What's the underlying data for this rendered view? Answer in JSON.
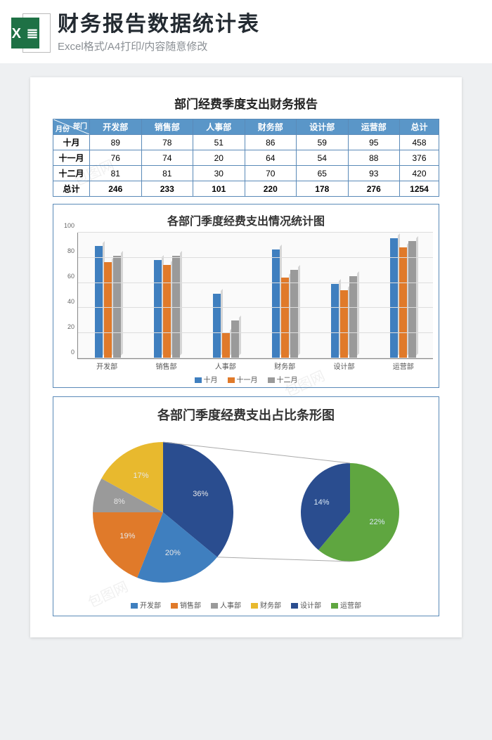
{
  "header": {
    "logo_text": "X ≣",
    "title": "财务报告数据统计表",
    "subtitle": "Excel格式/A4打印/内容随意修改"
  },
  "report_title": "部门经费季度支出财务报告",
  "table": {
    "corner": {
      "top": "部门",
      "bottom": "月份"
    },
    "columns": [
      "开发部",
      "销售部",
      "人事部",
      "财务部",
      "设计部",
      "运营部",
      "总计"
    ],
    "rows": [
      {
        "label": "十月",
        "values": [
          89,
          78,
          51,
          86,
          59,
          95,
          458
        ]
      },
      {
        "label": "十一月",
        "values": [
          76,
          74,
          20,
          64,
          54,
          88,
          376
        ]
      },
      {
        "label": "十二月",
        "values": [
          81,
          81,
          30,
          70,
          65,
          93,
          420
        ]
      },
      {
        "label": "总计",
        "values": [
          246,
          233,
          101,
          220,
          178,
          276,
          1254
        ]
      }
    ]
  },
  "bar_chart": {
    "title": "各部门季度经费支出情况统计图",
    "yticks": [
      0,
      20,
      40,
      60,
      80,
      100
    ],
    "legend": [
      "十月",
      "十一月",
      "十二月"
    ]
  },
  "pie_chart": {
    "title": "各部门季度经费支出占比条形图",
    "pie1_labels": {
      "a": "36%",
      "b": "20%",
      "c": "19%",
      "d": "8%",
      "e": "17%"
    },
    "pie2_labels": {
      "a": "14%",
      "b": "22%"
    },
    "legend": [
      "开发部",
      "销售部",
      "人事部",
      "财务部",
      "设计部",
      "运营部"
    ]
  },
  "chart_data": [
    {
      "type": "bar",
      "title": "各部门季度经费支出情况统计图",
      "categories": [
        "开发部",
        "销售部",
        "人事部",
        "财务部",
        "设计部",
        "运营部"
      ],
      "series": [
        {
          "name": "十月",
          "values": [
            89,
            78,
            51,
            86,
            59,
            95
          ]
        },
        {
          "name": "十一月",
          "values": [
            76,
            74,
            20,
            64,
            54,
            88
          ]
        },
        {
          "name": "十二月",
          "values": [
            81,
            81,
            30,
            70,
            65,
            93
          ]
        }
      ],
      "ylim": [
        0,
        100
      ],
      "ylabel": "",
      "xlabel": ""
    },
    {
      "type": "pie",
      "title": "各部门季度经费支出占比条形图 (主饼)",
      "categories": [
        "开发部",
        "销售部",
        "人事部",
        "财务部",
        "设计部+运营部"
      ],
      "values": [
        20,
        19,
        8,
        17,
        36
      ],
      "percent_labels": [
        "20%",
        "19%",
        "8%",
        "17%",
        "36%"
      ]
    },
    {
      "type": "pie",
      "title": "各部门季度经费支出占比条形图 (子饼)",
      "categories": [
        "设计部",
        "运营部"
      ],
      "values": [
        14,
        22
      ],
      "percent_labels": [
        "14%",
        "22%"
      ]
    }
  ]
}
